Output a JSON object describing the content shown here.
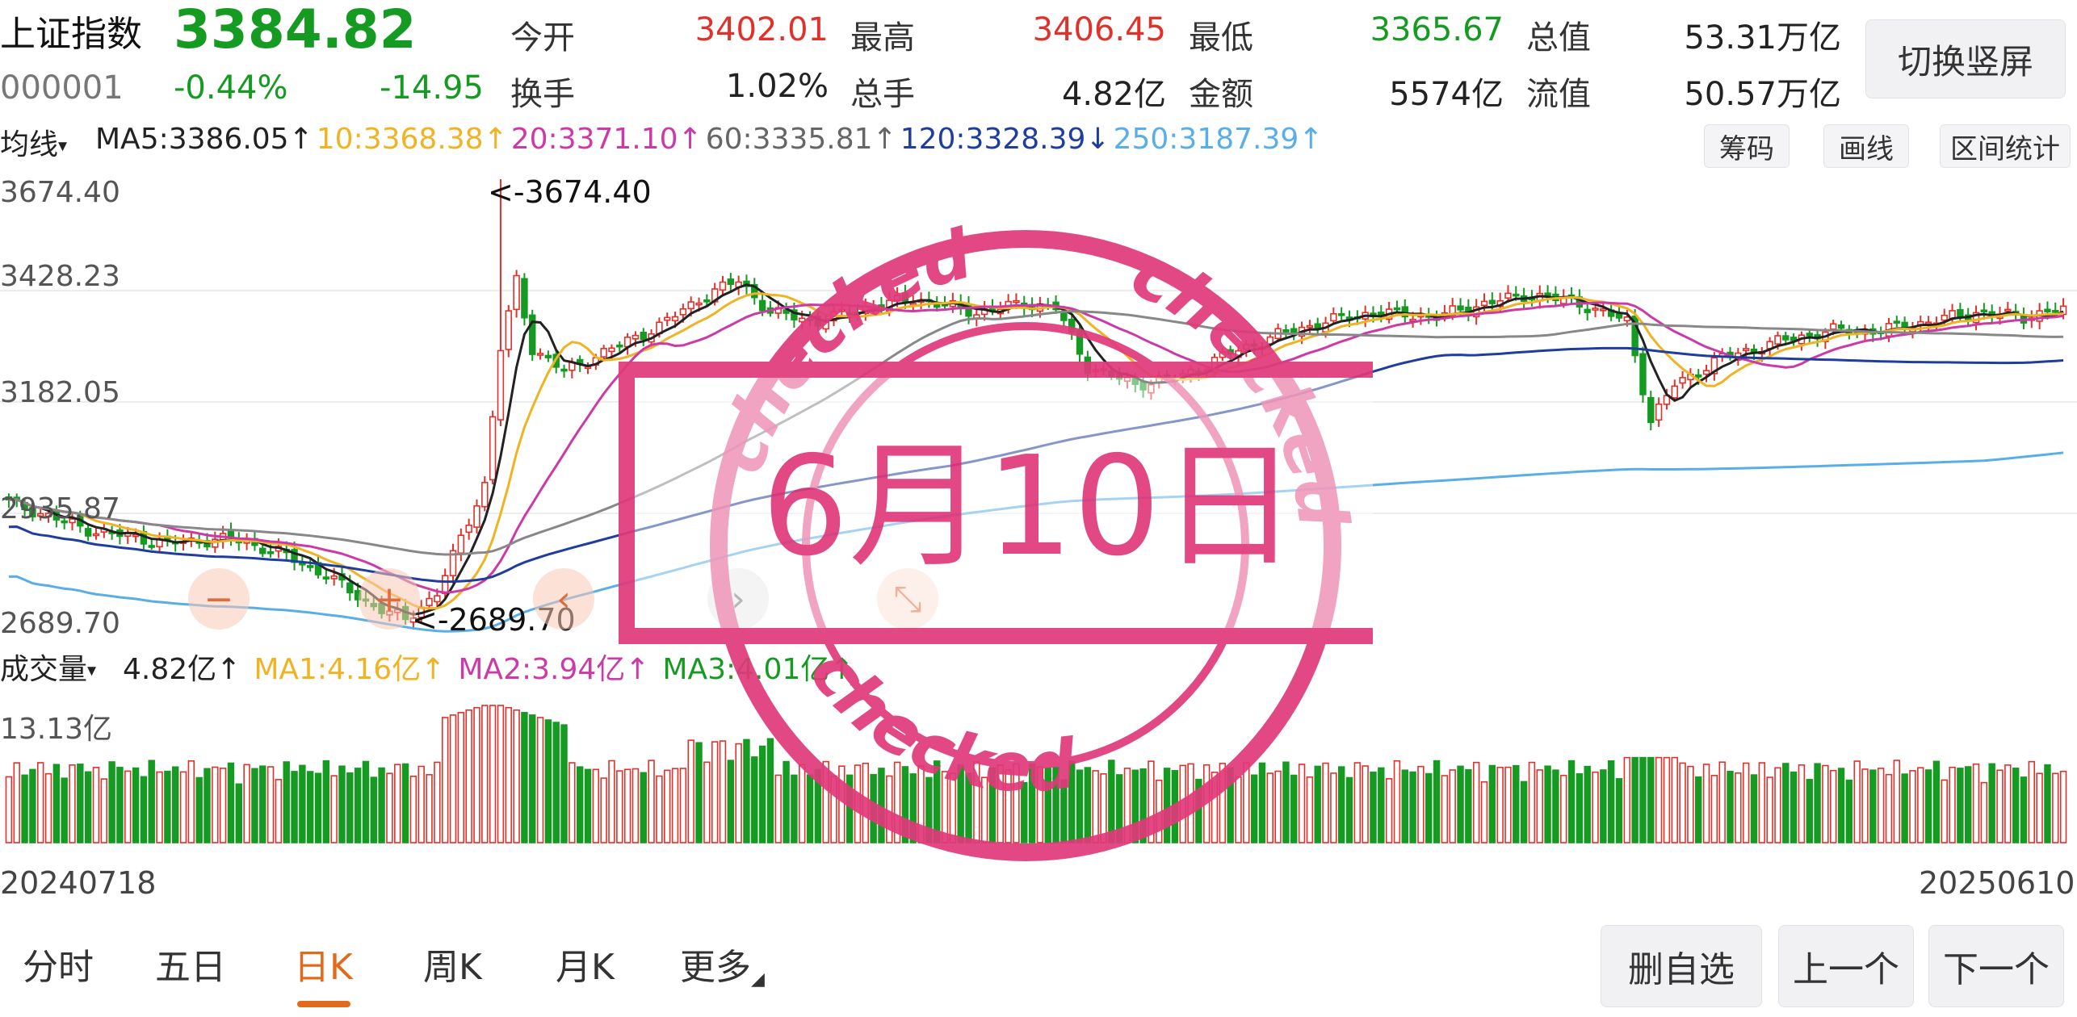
{
  "header": {
    "name": "上证指数",
    "price": "3384.82",
    "code": "000001",
    "pct": "-0.44%",
    "chg": "-14.95",
    "quotes": [
      {
        "label": "今开",
        "value": "3402.01",
        "color": "#e0312b"
      },
      {
        "label": "最高",
        "value": "3406.45",
        "color": "#e0312b"
      },
      {
        "label": "最低",
        "value": "3365.67",
        "color": "#159a22"
      },
      {
        "label": "总值",
        "value": "53.31万亿",
        "color": "#222222"
      },
      {
        "label": "换手",
        "value": "1.02%",
        "color": "#222222"
      },
      {
        "label": "总手",
        "value": "4.82亿",
        "color": "#222222"
      },
      {
        "label": "金额",
        "value": "5574亿",
        "color": "#222222"
      },
      {
        "label": "流值",
        "value": "50.57万亿",
        "color": "#222222"
      }
    ],
    "switch_label": "切换竖屏"
  },
  "ma_bar": {
    "selector": "均线",
    "items": [
      {
        "text": "MA5:3386.05↑",
        "color": "#222222"
      },
      {
        "text": "10:3368.38↑",
        "color": "#f0b323"
      },
      {
        "text": "20:3371.10↑",
        "color": "#cc3aa8"
      },
      {
        "text": "60:3335.81↑",
        "color": "#666666"
      },
      {
        "text": "120:3328.39↓",
        "color": "#1f3d9e"
      },
      {
        "text": "250:3187.39↑",
        "color": "#5aaee8"
      }
    ],
    "tools": [
      "筹码",
      "画线",
      "区间统计"
    ]
  },
  "price_axis": [
    "3674.40",
    "3428.23",
    "3182.05",
    "2935.87",
    "2689.70"
  ],
  "annotations": {
    "high": "<-3674.40",
    "low": "<-2689.70"
  },
  "volume_bar": {
    "selector": "成交量",
    "items": [
      {
        "text": "4.82亿↑",
        "color": "#222222"
      },
      {
        "text": "MA1:4.16亿↑",
        "color": "#f0b323"
      },
      {
        "text": "MA2:3.94亿↑",
        "color": "#cc3aa8"
      },
      {
        "text": "MA3:4.01亿↑",
        "color": "#159a22"
      }
    ],
    "axis_top": "13.13亿"
  },
  "dates": {
    "start": "20240718",
    "end": "20250610"
  },
  "stamp": {
    "date": "6月10日",
    "ring_text": "checked"
  },
  "tabs": [
    "分时",
    "五日",
    "日K",
    "周K",
    "月K",
    "更多"
  ],
  "active_tab": "日K",
  "buttons": {
    "delete": "删自选",
    "prev": "上一个",
    "next": "下一个"
  },
  "chart_controls": {
    "zoom_out": "−",
    "zoom_in": "+",
    "left": "‹",
    "right": "›",
    "collapse": "⤡"
  },
  "colors": {
    "up": "#e0312b",
    "down": "#159a22",
    "accent": "#e26a1c",
    "stamp": "#e03a7a"
  },
  "chart_data": {
    "type": "candlestick",
    "ylim": [
      2689.7,
      3674.4
    ],
    "marked_high": 3674.4,
    "marked_low": 2689.7,
    "anchors": [
      [
        0,
        2960
      ],
      [
        10,
        2900
      ],
      [
        20,
        2870
      ],
      [
        28,
        2880
      ],
      [
        34,
        2850
      ],
      [
        40,
        2800
      ],
      [
        45,
        2740
      ],
      [
        50,
        2700
      ],
      [
        54,
        2760
      ],
      [
        57,
        2880
      ],
      [
        60,
        3000
      ],
      [
        62,
        3300
      ],
      [
        64,
        3450
      ],
      [
        66,
        3300
      ],
      [
        70,
        3250
      ],
      [
        76,
        3300
      ],
      [
        82,
        3350
      ],
      [
        88,
        3420
      ],
      [
        92,
        3450
      ],
      [
        96,
        3380
      ],
      [
        102,
        3360
      ],
      [
        108,
        3390
      ],
      [
        114,
        3410
      ],
      [
        122,
        3380
      ],
      [
        128,
        3400
      ],
      [
        132,
        3390
      ],
      [
        136,
        3260
      ],
      [
        142,
        3220
      ],
      [
        148,
        3240
      ],
      [
        154,
        3290
      ],
      [
        160,
        3330
      ],
      [
        166,
        3360
      ],
      [
        172,
        3380
      ],
      [
        180,
        3370
      ],
      [
        186,
        3400
      ],
      [
        192,
        3420
      ],
      [
        198,
        3400
      ],
      [
        204,
        3360
      ],
      [
        207,
        3140
      ],
      [
        210,
        3220
      ],
      [
        216,
        3280
      ],
      [
        224,
        3320
      ],
      [
        230,
        3340
      ],
      [
        236,
        3340
      ],
      [
        242,
        3360
      ],
      [
        248,
        3380
      ],
      [
        254,
        3370
      ],
      [
        258,
        3384.82
      ]
    ]
  }
}
